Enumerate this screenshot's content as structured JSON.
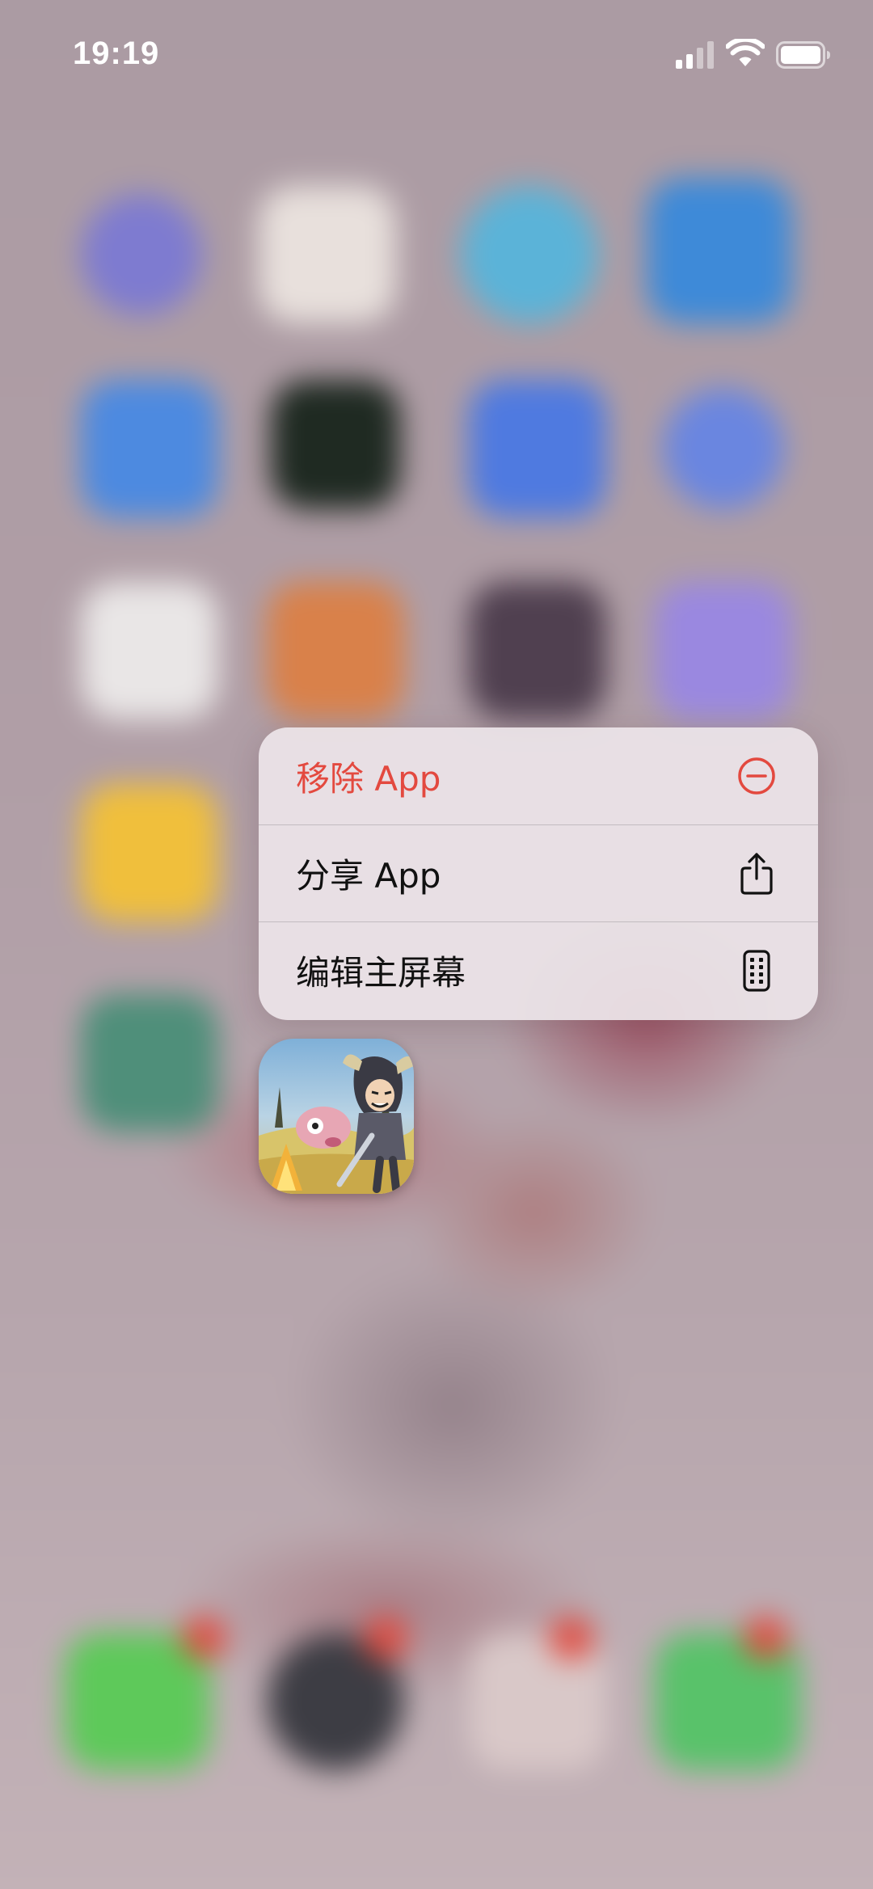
{
  "status_bar": {
    "time": "19:19",
    "signal_icon": "cellular-signal-icon",
    "wifi_icon": "wifi-icon",
    "battery_icon": "battery-icon"
  },
  "context_menu": {
    "items": [
      {
        "label": "移除 App",
        "icon": "minus-circle-icon",
        "destructive": true,
        "color": "#e3493f"
      },
      {
        "label": "分享 App",
        "icon": "share-icon",
        "destructive": false
      },
      {
        "label": "编辑主屏幕",
        "icon": "phone-screen-icon",
        "destructive": false
      }
    ]
  },
  "app": {
    "icon": "game-app-icon"
  }
}
